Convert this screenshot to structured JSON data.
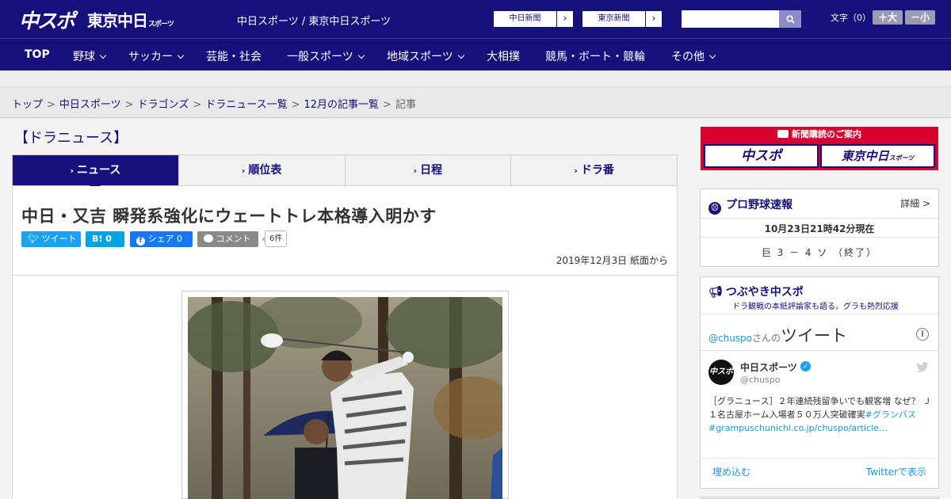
{
  "header": {
    "logo_chuspo": "中スポ",
    "logo_tokyo": "東京中日",
    "logo_tokyo_small": "スポーツ",
    "site_name": "中日スポーツ / 東京中日スポーツ",
    "paper_buttons": [
      {
        "label": "中日新聞"
      },
      {
        "label": "東京新聞"
      }
    ],
    "search": {
      "value": "",
      "placeholder": ""
    },
    "font_size": {
      "label": "文字（0）",
      "larger": "＋大",
      "smaller": "－小"
    }
  },
  "nav": {
    "items": [
      {
        "label": "TOP"
      },
      {
        "label": "野球"
      },
      {
        "label": "サッカー"
      },
      {
        "label": "芸能・社会"
      },
      {
        "label": "一般スポーツ"
      },
      {
        "label": "地域スポーツ"
      },
      {
        "label": "大相撲"
      },
      {
        "label": "競馬・ボート・競輪"
      },
      {
        "label": "その他"
      }
    ]
  },
  "breadcrumb": {
    "items": [
      "トップ",
      "中日スポーツ",
      "ドラゴンズ",
      "ドラニュース一覧",
      "12月の記事一覧"
    ],
    "current": "記事",
    "separator": ">"
  },
  "section_title": "【ドラニュース】",
  "tabs": [
    {
      "label": "ニュース",
      "active": true
    },
    {
      "label": "順位表",
      "active": false
    },
    {
      "label": "日程",
      "active": false
    },
    {
      "label": "ドラ番",
      "active": false
    }
  ],
  "article": {
    "headline": "中日・又吉 瞬発系強化にウェートトレ本格導入明かす",
    "share": {
      "tweet": "ツイート",
      "hatena": "B! 0",
      "facebook": "シェア 0",
      "comment": "コメント",
      "comment_count": "6件"
    },
    "date": "2019年12月3日 紙面から"
  },
  "sidebar": {
    "subscribe": {
      "header": "新聞購読のご案内",
      "chuspo": "中スポ",
      "tokyo": "東京中日",
      "tokyo_small": "スポーツ"
    },
    "scores": {
      "title": "プロ野球速報",
      "more": "詳細 >",
      "time": "10月23日21時42分現在",
      "game": "巨 3 － 4 ソ （終了）"
    },
    "tweets": {
      "title": "つぶやき中スポ",
      "subtitle": "ドラ観戦の本紙評論家も語る。グラも熱烈応援",
      "header_handle": "@chuspo",
      "header_mid": "さんの",
      "header_big": "ツイート",
      "account_name": "中日スポーツ",
      "account_handle": "@chuspo",
      "avatar_text": "中スポ",
      "tweet_text": "［グラニュース］２年連続残留争いでも観客増 なぜ？ Ｊ１名古屋ホーム入場者５０万人突破確実",
      "tweet_hashtag": "#グランパス",
      "tweet_link": "#grampuschunichi.co.jp/chuspo/article…",
      "embed": "埋め込む",
      "view_on": "Twitterで表示"
    }
  },
  "colors": {
    "brand_navy": "#15107a",
    "twitter_blue": "#1da1f2",
    "hatena": "#00a4de",
    "facebook": "#1877f2",
    "banner_red": "#d8002d"
  }
}
